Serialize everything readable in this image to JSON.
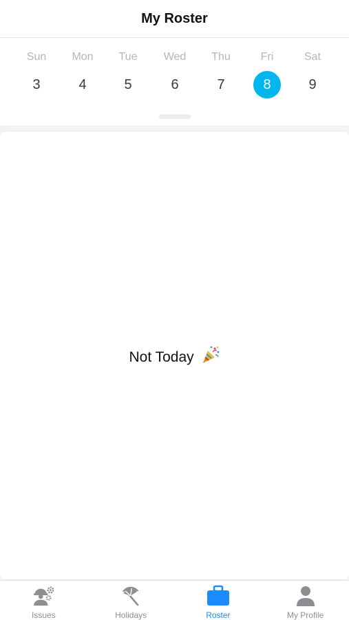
{
  "header": {
    "title": "My Roster"
  },
  "week": {
    "days": [
      {
        "name": "Sun",
        "num": "3"
      },
      {
        "name": "Mon",
        "num": "4"
      },
      {
        "name": "Tue",
        "num": "5"
      },
      {
        "name": "Wed",
        "num": "6"
      },
      {
        "name": "Thu",
        "num": "7"
      },
      {
        "name": "Fri",
        "num": "8"
      },
      {
        "name": "Sat",
        "num": "9"
      }
    ],
    "selected_index": 5,
    "selected_color": "#00b6ef"
  },
  "content": {
    "empty_message": "Not Today",
    "empty_icon": "party-popper-icon"
  },
  "tabbar": {
    "active_color": "#1a8cff",
    "inactive_color": "#8e8e93",
    "tabs": [
      {
        "label": "Issues",
        "icon": "worker-gear-icon"
      },
      {
        "label": "Holidays",
        "icon": "beach-umbrella-icon"
      },
      {
        "label": "Roster",
        "icon": "briefcase-icon",
        "active": true
      },
      {
        "label": "My Profile",
        "icon": "person-icon"
      }
    ]
  }
}
